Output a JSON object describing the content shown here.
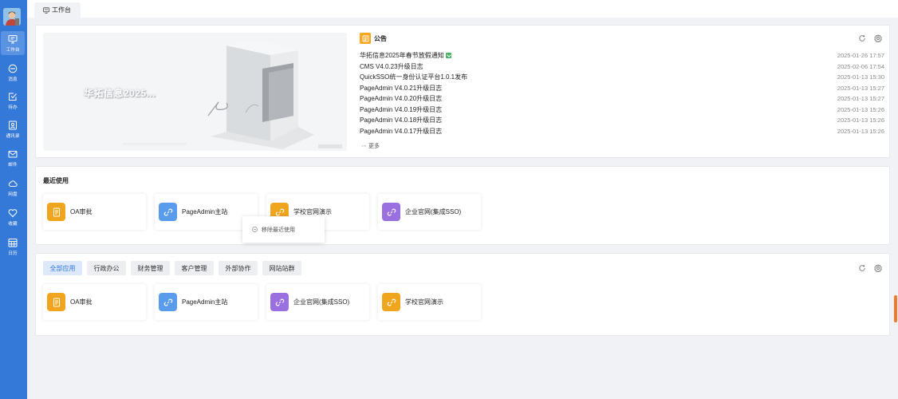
{
  "sidebar": {
    "items": [
      {
        "label": "工作台",
        "icon": "monitor-icon",
        "active": true
      },
      {
        "label": "消息",
        "icon": "message-icon"
      },
      {
        "label": "待办",
        "icon": "todo-icon"
      },
      {
        "label": "通讯录",
        "icon": "contacts-icon"
      },
      {
        "label": "邮件",
        "icon": "mail-icon"
      },
      {
        "label": "网盘",
        "icon": "cloud-icon"
      },
      {
        "label": "收藏",
        "icon": "heart-icon"
      },
      {
        "label": "日历",
        "icon": "calendar-icon"
      }
    ]
  },
  "topbar": {
    "tab_label": "工作台"
  },
  "notice": {
    "hero_title": "华拓信息2025...",
    "title": "公告",
    "more_label": "更多",
    "items": [
      {
        "title": "华拓信息2025年春节放假通知",
        "date": "2025-01-26 17:57",
        "is_new": true
      },
      {
        "title": "CMS V4.0.23升级日志",
        "date": "2025-02-06 17:54"
      },
      {
        "title": "QuickSSO统一身份认证平台1.0.1发布",
        "date": "2025-01-13 15:30"
      },
      {
        "title": "PageAdmin V4.0.21升级日志",
        "date": "2025-01-13 15:27"
      },
      {
        "title": "PageAdmin V4.0.20升级日志",
        "date": "2025-01-13 15:27"
      },
      {
        "title": "PageAdmin V4.0.19升级日志",
        "date": "2025-01-13 15:26"
      },
      {
        "title": "PageAdmin V4.0.18升级日志",
        "date": "2025-01-13 15:26"
      },
      {
        "title": "PageAdmin V4.0.17升级日志",
        "date": "2025-01-13 15:26"
      }
    ]
  },
  "recent": {
    "title": "最近使用",
    "apps": [
      {
        "name": "OA审批",
        "color": "orange",
        "icon": "document-icon"
      },
      {
        "name": "PageAdmin主站",
        "color": "blue",
        "icon": "link-icon"
      },
      {
        "name": "学校官网演示",
        "color": "orange",
        "icon": "link-icon"
      },
      {
        "name": "企业官网(集成SSO)",
        "color": "purple",
        "icon": "link-icon"
      }
    ],
    "context_menu_label": "移除最近使用"
  },
  "all_apps": {
    "tabs": [
      {
        "label": "全部应用",
        "active": true
      },
      {
        "label": "行政办公"
      },
      {
        "label": "财务管理"
      },
      {
        "label": "客户管理"
      },
      {
        "label": "外部协作"
      },
      {
        "label": "网站站群"
      }
    ],
    "apps": [
      {
        "name": "OA审批",
        "color": "orange",
        "icon": "document-icon"
      },
      {
        "name": "PageAdmin主站",
        "color": "blue",
        "icon": "link-icon"
      },
      {
        "name": "企业官网(集成SSO)",
        "color": "purple",
        "icon": "link-icon"
      },
      {
        "name": "学校官网演示",
        "color": "orange",
        "icon": "link-icon"
      }
    ]
  },
  "colors": {
    "sidebar": "#3478d8",
    "accent_orange": "#f0a51e",
    "accent_blue": "#5a9cec",
    "accent_purple": "#9a6fe0",
    "new_badge": "#49b35f"
  }
}
